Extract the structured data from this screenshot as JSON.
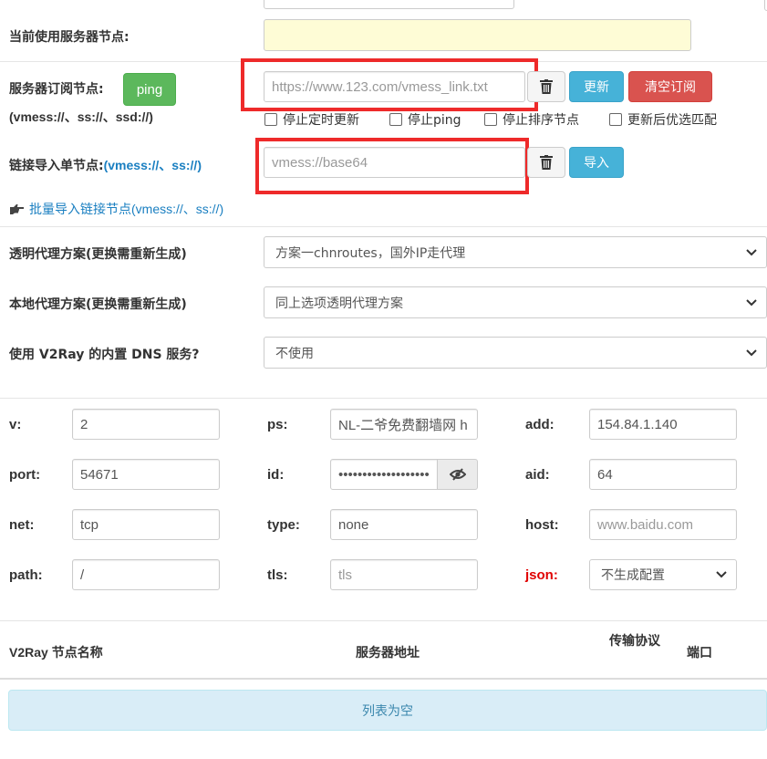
{
  "current_server": {
    "label": "当前使用服务器节点:"
  },
  "subscription": {
    "label": "服务器订阅节点:",
    "protocols": "(vmess://、ss://、ssd://)",
    "ping_label": "ping",
    "url_placeholder": "https://www.123.com/vmess_link.txt",
    "update_label": "更新",
    "clear_label": "清空订阅",
    "checkboxes": [
      "停止定时更新",
      "停止ping",
      "停止排序节点",
      "更新后优选匹配"
    ]
  },
  "link_import": {
    "label_prefix": "链接导入单节点:",
    "label_protocols": "(vmess://、ss://)",
    "placeholder": "vmess://base64",
    "import_label": "导入",
    "batch_icon": "hand-pointing-right-icon",
    "batch_prefix": "批量导入链接节点",
    "batch_suffix": "(vmess://、ss://)"
  },
  "transparent_proxy": {
    "label": "透明代理方案(更换需重新生成)",
    "value": "方案一chnroutes，国外IP走代理"
  },
  "local_proxy": {
    "label": "本地代理方案(更换需重新生成)",
    "value": "同上选项透明代理方案"
  },
  "dns": {
    "label": "使用 V2Ray 的内置 DNS 服务?",
    "value": "不使用"
  },
  "fields": {
    "v": {
      "label": "v:",
      "value": "2"
    },
    "ps": {
      "label": "ps:",
      "value": "NL-二爷免费翻墙网 h"
    },
    "add": {
      "label": "add:",
      "value": "154.84.1.140"
    },
    "port": {
      "label": "port:",
      "value": "54671"
    },
    "id": {
      "label": "id:",
      "value": "•••••••••••••••••••"
    },
    "aid": {
      "label": "aid:",
      "value": "64"
    },
    "net": {
      "label": "net:",
      "value": "tcp"
    },
    "type": {
      "label": "type:",
      "value": "none"
    },
    "host": {
      "label": "host:",
      "placeholder": "www.baidu.com"
    },
    "path": {
      "label": "path:",
      "value": "/"
    },
    "tls": {
      "label": "tls:",
      "placeholder": "tls"
    },
    "json": {
      "label": "json:",
      "value": "不生成配置"
    }
  },
  "table": {
    "headers": [
      "V2Ray 节点名称",
      "服务器地址",
      "传输协议",
      "端口"
    ],
    "empty_text": "列表为空"
  },
  "colors": {
    "accent_blue": "#46b2d8",
    "ping_green": "#5cb85c",
    "clear_red": "#d9534f",
    "highlight_frame": "#ee2a2a",
    "link_blue": "#1a7fc1",
    "json_label_red": "#e00000",
    "current_server_bg": "#fefcd6",
    "empty_list_bg": "#d9edf7"
  }
}
